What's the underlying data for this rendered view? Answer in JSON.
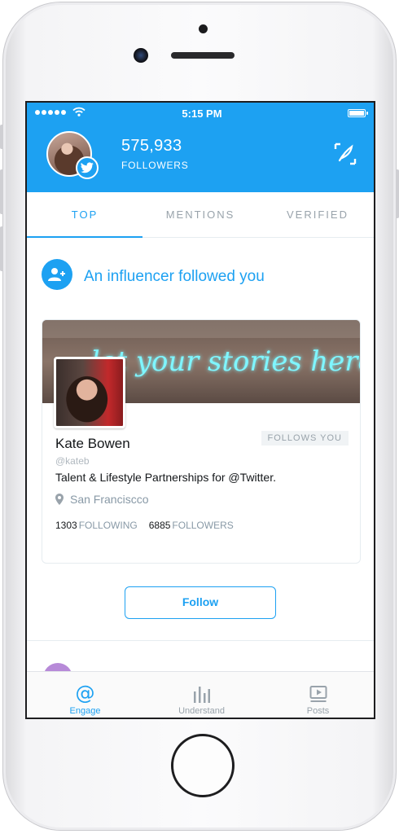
{
  "status_bar": {
    "time": "5:15 PM"
  },
  "header": {
    "followers_count": "575,933",
    "followers_label": "FOLLOWERS"
  },
  "tabs": [
    {
      "label": "TOP",
      "active": true
    },
    {
      "label": "MENTIONS",
      "active": false
    },
    {
      "label": "VERIFIED",
      "active": false
    }
  ],
  "notification": {
    "title": "An influencer followed you",
    "card": {
      "banner_text": "let your stories here",
      "name": "Kate Bowen",
      "handle": "@kateb",
      "follows_you": "FOLLOWS YOU",
      "bio": "Talent & Lifestyle Partnerships for @Twitter.",
      "location": "San Franciscco",
      "following_count": "1303",
      "following_label": "FOLLOWING",
      "followers_count": "6885",
      "followers_label": "FOLLOWERS"
    },
    "follow_button": "Follow"
  },
  "tabbar": [
    {
      "label": "Engage",
      "icon": "at-icon",
      "active": true
    },
    {
      "label": "Understand",
      "icon": "bar-chart-icon",
      "active": false
    },
    {
      "label": "Posts",
      "icon": "play-post-icon",
      "active": false
    }
  ],
  "colors": {
    "accent": "#1da1f2",
    "muted": "#99a3ab"
  }
}
